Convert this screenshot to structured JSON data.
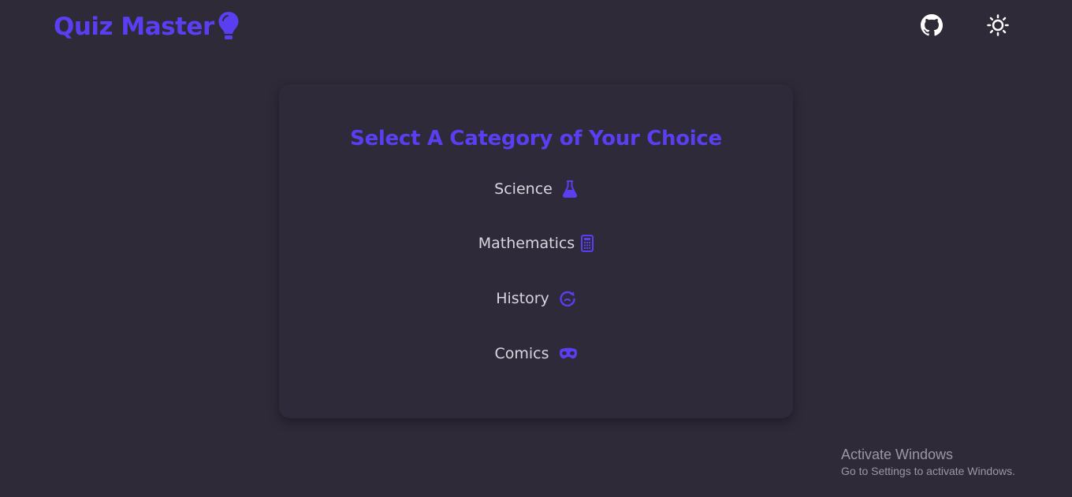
{
  "header": {
    "title": "Quiz Master",
    "logo_icon": "lightbulb-icon",
    "github_icon": "github-icon",
    "theme_icon": "sun-icon"
  },
  "card": {
    "title": "Select A Category of Your Choice",
    "categories": [
      {
        "label": "Science",
        "icon": "flask-icon"
      },
      {
        "label": "Mathematics",
        "icon": "calculator-icon"
      },
      {
        "label": "History",
        "icon": "history-icon"
      },
      {
        "label": "Comics",
        "icon": "mask-icon"
      }
    ]
  },
  "watermark": {
    "line1": "Activate Windows",
    "line2": "Go to Settings to activate Windows."
  },
  "colors": {
    "accent": "#5a3ff2",
    "background": "#2e2a38",
    "text": "#d8d6de"
  }
}
